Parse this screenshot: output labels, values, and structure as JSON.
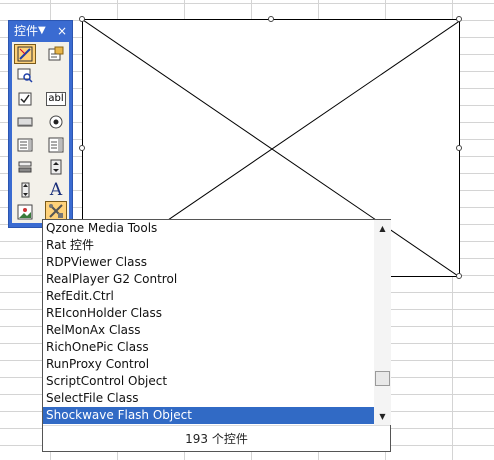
{
  "toolbox": {
    "title": "控件工具箱",
    "dropdown_icon": "▼",
    "close_icon": "×",
    "tools": [
      {
        "name": "design-mode-icon",
        "active": true
      },
      {
        "name": "properties-icon"
      },
      {
        "name": "view-code-icon"
      },
      {
        "name": "checkbox-icon"
      },
      {
        "name": "textbox-icon",
        "label": "abl"
      },
      {
        "name": "command-button-icon"
      },
      {
        "name": "option-button-icon"
      },
      {
        "name": "listbox-icon"
      },
      {
        "name": "combobox-icon"
      },
      {
        "name": "toggle-button-icon"
      },
      {
        "name": "spin-button-icon"
      },
      {
        "name": "scroll-bar-icon"
      },
      {
        "name": "label-icon",
        "label": "A"
      },
      {
        "name": "image-icon"
      },
      {
        "name": "more-controls-icon"
      }
    ]
  },
  "control_list": {
    "items": [
      "Qzone Media Tools",
      "Rat 控件",
      "RDPViewer Class",
      "RealPlayer G2 Control",
      "RefEdit.Ctrl",
      "REIconHolder Class",
      "RelMonAx Class",
      "RichOnePic Class",
      "RunProxy Control",
      "ScriptControl Object",
      "SelectFile Class",
      "Shockwave Flash Object"
    ],
    "selected_index": 11,
    "count_label": "193 个控件"
  }
}
